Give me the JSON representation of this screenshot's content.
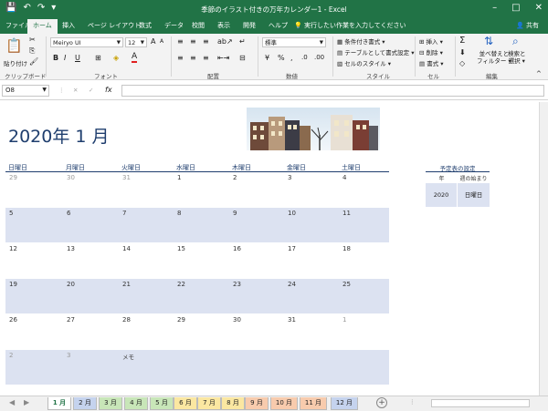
{
  "titlebar": {
    "title": "季節のイラスト付きの万年カレンダー1 - Excel",
    "save_icon": "💾",
    "undo_icon": "↶",
    "redo_icon": "↷",
    "customize_icon": "▾",
    "minimize_icon": "–",
    "restore_icon": "□",
    "close_icon": "✕"
  },
  "tabs": [
    "ファイル",
    "ホーム",
    "挿入",
    "ページ レイアウト",
    "数式",
    "データ",
    "校閲",
    "表示",
    "開発",
    "ヘルプ"
  ],
  "tell_me": "実行したい作業を入力してください",
  "share": "共有",
  "ribbon": {
    "clipboard": {
      "paste": "貼り付け",
      "label": "クリップボード"
    },
    "font": {
      "name": "Meiryo UI",
      "size": "12",
      "bold": "B",
      "italic": "I",
      "underline": "U",
      "grow": "A",
      "shrink": "A",
      "label": "フォント"
    },
    "alignment": {
      "label": "配置"
    },
    "number": {
      "format": "標準",
      "currency": "%",
      "percent": "%",
      "comma": ",",
      "label": "数値"
    },
    "styles": {
      "conditional": "条件付き書式 ▾",
      "table": "テーブルとして書式設定 ▾",
      "cell": "セルのスタイル ▾",
      "label": "スタイル"
    },
    "cells": {
      "insert": "挿入 ▾",
      "delete": "削除 ▾",
      "format": "書式 ▾",
      "label": "セル"
    },
    "editing": {
      "sort": "並べ替えと\nフィルター ▾",
      "find": "検索と\n選択 ▾",
      "label": "編集"
    }
  },
  "formula_bar": {
    "name_box": "O8",
    "cancel": "✕",
    "enter": "✓",
    "fx": "fx",
    "value": ""
  },
  "calendar": {
    "title": "2020年 1 月",
    "weekdays": [
      "日曜日",
      "月曜日",
      "火曜日",
      "水曜日",
      "木曜日",
      "金曜日",
      "土曜日"
    ],
    "weeks": [
      [
        "29",
        "30",
        "31",
        "1",
        "2",
        "3",
        "4"
      ],
      [
        "5",
        "6",
        "7",
        "8",
        "9",
        "10",
        "11"
      ],
      [
        "12",
        "13",
        "14",
        "15",
        "16",
        "17",
        "18"
      ],
      [
        "19",
        "20",
        "21",
        "22",
        "23",
        "24",
        "25"
      ],
      [
        "26",
        "27",
        "28",
        "29",
        "30",
        "31",
        "1"
      ],
      [
        "2",
        "3",
        "",
        "",
        "",
        "",
        ""
      ]
    ],
    "memo": "メモ"
  },
  "settings": {
    "title": "予定表の設定",
    "year_label": "年",
    "start_label": "週の始まり",
    "year": "2020",
    "start_day": "日曜日"
  },
  "sheet_tabs": [
    "1 月",
    "2 月",
    "3 月",
    "4 月",
    "5 月",
    "6 月",
    "7 月",
    "8 月",
    "9 月",
    "10 月",
    "11 月",
    "12 月"
  ],
  "sheet_tab_colors": [
    "#ffffff",
    "#c5d3ee",
    "#c8e6b8",
    "#c8e6b8",
    "#c8e6b8",
    "#fbe7a1",
    "#fbe7a1",
    "#fbe7a1",
    "#f8cbad",
    "#f8cbad",
    "#f8cbad",
    "#c5d3ee"
  ],
  "add_sheet": "+",
  "nav_prev": "◀",
  "nav_next": "▶"
}
